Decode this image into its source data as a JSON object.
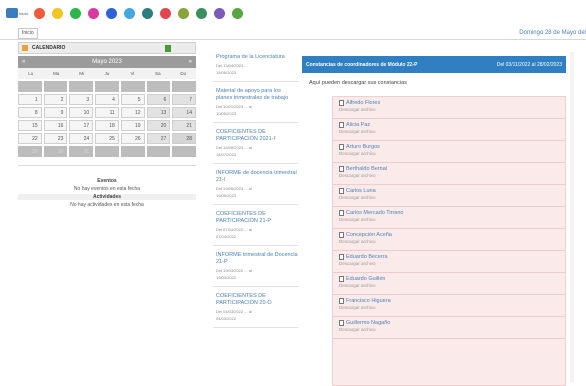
{
  "topbar": {
    "home_label": "Inicio",
    "icons": [
      {
        "name": "orange-icon",
        "color": "#ef5a3a"
      },
      {
        "name": "yellow-icon",
        "color": "#f2c523"
      },
      {
        "name": "green-icon",
        "color": "#2cb54a"
      },
      {
        "name": "magenta-icon",
        "color": "#d93aa1"
      },
      {
        "name": "blue-icon",
        "color": "#2d62d8"
      },
      {
        "name": "lightblue-icon",
        "color": "#43a7e0"
      },
      {
        "name": "teal-icon",
        "color": "#2d7d7e"
      },
      {
        "name": "red-icon",
        "color": "#e0474e"
      },
      {
        "name": "olive-icon",
        "color": "#8aa33a"
      },
      {
        "name": "darkgreen-icon",
        "color": "#3a8f5d"
      },
      {
        "name": "purple-icon",
        "color": "#7b5bb7"
      },
      {
        "name": "grass-icon",
        "color": "#5aa646"
      }
    ]
  },
  "tab": {
    "label": "Inicio"
  },
  "date_label": "Domingo 28 de Mayo del",
  "calendar": {
    "title": "CALENDARIO",
    "prev": "«",
    "month": "Mayo 2023",
    "next": "»",
    "days_of_week": [
      "Lu",
      "Ma",
      "Mi",
      "Ju",
      "Vi",
      "Sa",
      "Do"
    ],
    "weeks": [
      [
        "",
        "",
        "",
        "",
        "",
        "",
        ""
      ],
      [
        "1",
        "2",
        "3",
        "4",
        "5",
        "6",
        "7"
      ],
      [
        "8",
        "9",
        "10",
        "11",
        "12",
        "13",
        "14"
      ],
      [
        "15",
        "16",
        "17",
        "18",
        "19",
        "20",
        "21"
      ],
      [
        "22",
        "23",
        "24",
        "25",
        "26",
        "27",
        "28"
      ],
      [
        "29",
        "30",
        "31",
        "",
        "",
        "",
        ""
      ]
    ]
  },
  "events": {
    "title": "Eventos",
    "text": "No hay eventos en esta fecha",
    "activities_title": "Actividades",
    "activities_text": "No hay actividades en esta fecha"
  },
  "news": [
    {
      "title": "Programa de la Licenciatura",
      "meta": "Del 13/04/2023 ...",
      "date": "15/06/2023"
    },
    {
      "title": "Material de apoyo para los planes trimestrales de trabajo",
      "meta": "Del 10/01/2023 ... al",
      "date": "10/05/2023"
    },
    {
      "title": "COEFICIENTES DE PARTICIPACIÓN 2021-I",
      "meta": "Del 15/09/2023 ... al",
      "date": "15/07/2023"
    },
    {
      "title": "INFORME de docencia trimestral 21-I",
      "meta": "Del 19/05/2023 ... al",
      "date": "19/05/2023"
    },
    {
      "title": "COEFICIENTES DE PARTICIPACIÓN 21-P",
      "meta": "Del 07/04/2022 ... al",
      "date": "07/04/2022"
    },
    {
      "title": "INFORME trimestral de Docencia 21-P",
      "meta": "Del 19/03/2022 ... al",
      "date": "19/03/2022"
    },
    {
      "title": "COEFICIENTES DE PARTICIPACIÓN 20-O",
      "meta": "Del 04/03/2022 ... al",
      "date": "04/03/2022"
    }
  ],
  "constancias": {
    "title": "Constancias de coordinadores de Módulo 22-P",
    "period": "Del 03/11/2022 al 28/02/2023",
    "intro": "Aquí pueden descargar sus constancias",
    "download_label": "Descargar archivo",
    "entries": [
      "Alfredo Flores",
      "Alicia Paz",
      "Arturo Burgos",
      "Berthaldo Bernal",
      "Carlos Luna",
      "Carlos Mercado Tirrano",
      "Concepción Aceña",
      "Eduardo Becerra",
      "Eduardo Guillén",
      "Francisco Higuera",
      "Guillermo Nagaño"
    ]
  }
}
